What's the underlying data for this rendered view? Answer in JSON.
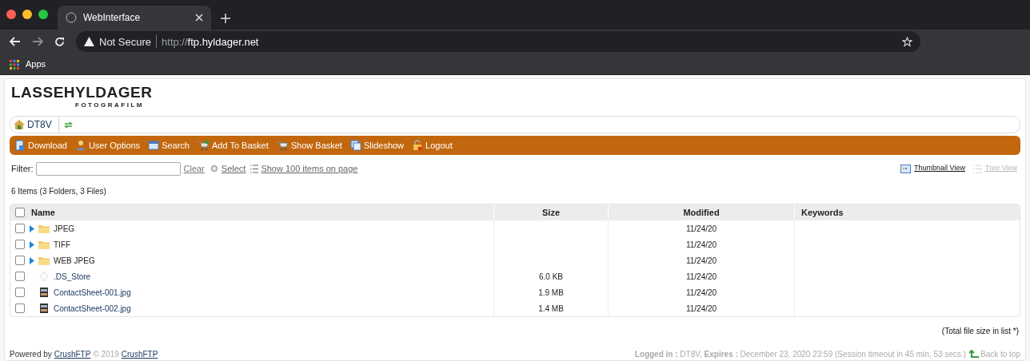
{
  "browser": {
    "tab_title": "WebInterface",
    "security": "Not Secure",
    "url_scheme": "http://",
    "url_host": "ftp.hyldager.net",
    "bookmark": "Apps"
  },
  "logo": {
    "title": "LASSEHYLDAGER",
    "subtitle": "FOTOGRAFILM"
  },
  "breadcrumb": [
    "DT8V"
  ],
  "toolbar": [
    {
      "kind": "download",
      "label": "Download"
    },
    {
      "kind": "user",
      "label": "User Options"
    },
    {
      "kind": "search",
      "label": "Search"
    },
    {
      "kind": "basket-add",
      "label": "Add To Basket"
    },
    {
      "kind": "basket",
      "label": "Show Basket"
    },
    {
      "kind": "slideshow",
      "label": "Slideshow"
    },
    {
      "kind": "logout",
      "label": "Logout"
    }
  ],
  "filter": {
    "label": "Filter:",
    "clear": "Clear",
    "select": "Select",
    "show_items": "Show 100 items on page"
  },
  "views": [
    {
      "label": "Thumbnail View",
      "selected": true
    },
    {
      "label": "Tree View",
      "selected": false
    }
  ],
  "summary": "6 Items (3 Folders, 3 Files)",
  "table": {
    "select_all_checked": false,
    "columns": [
      "Name",
      "Size",
      "Modified",
      "Keywords"
    ],
    "rows": [
      {
        "kind": "folder",
        "checked": false,
        "name": "JPEG",
        "size": "",
        "modified": "11/24/20"
      },
      {
        "kind": "folder",
        "checked": false,
        "name": "TIFF",
        "size": "",
        "modified": "11/24/20"
      },
      {
        "kind": "folder",
        "checked": false,
        "name": "WEB JPEG",
        "size": "",
        "modified": "11/24/20"
      },
      {
        "kind": "file",
        "checked": false,
        "name": ".DS_Store",
        "size": "6.0 KB",
        "modified": "11/24/20"
      },
      {
        "kind": "image",
        "checked": false,
        "name": "ContactSheet-001.jpg",
        "size": "1.9 MB",
        "modified": "11/24/20"
      },
      {
        "kind": "image",
        "checked": false,
        "name": "ContactSheet-002.jpg",
        "size": "1.4 MB",
        "modified": "11/24/20"
      }
    ]
  },
  "total_note": "(Total file size in list *)",
  "footer": {
    "powered_by": "Powered by",
    "link": "CrushFTP",
    "copyright": "© 2019",
    "link2": "CrushFTP",
    "session": "**Logged in :** DT8V, **Expires :** December 23, 2020 23:59 (Session timeout in 45 min, 53 secs.)",
    "back_to_top": "Back to top"
  }
}
